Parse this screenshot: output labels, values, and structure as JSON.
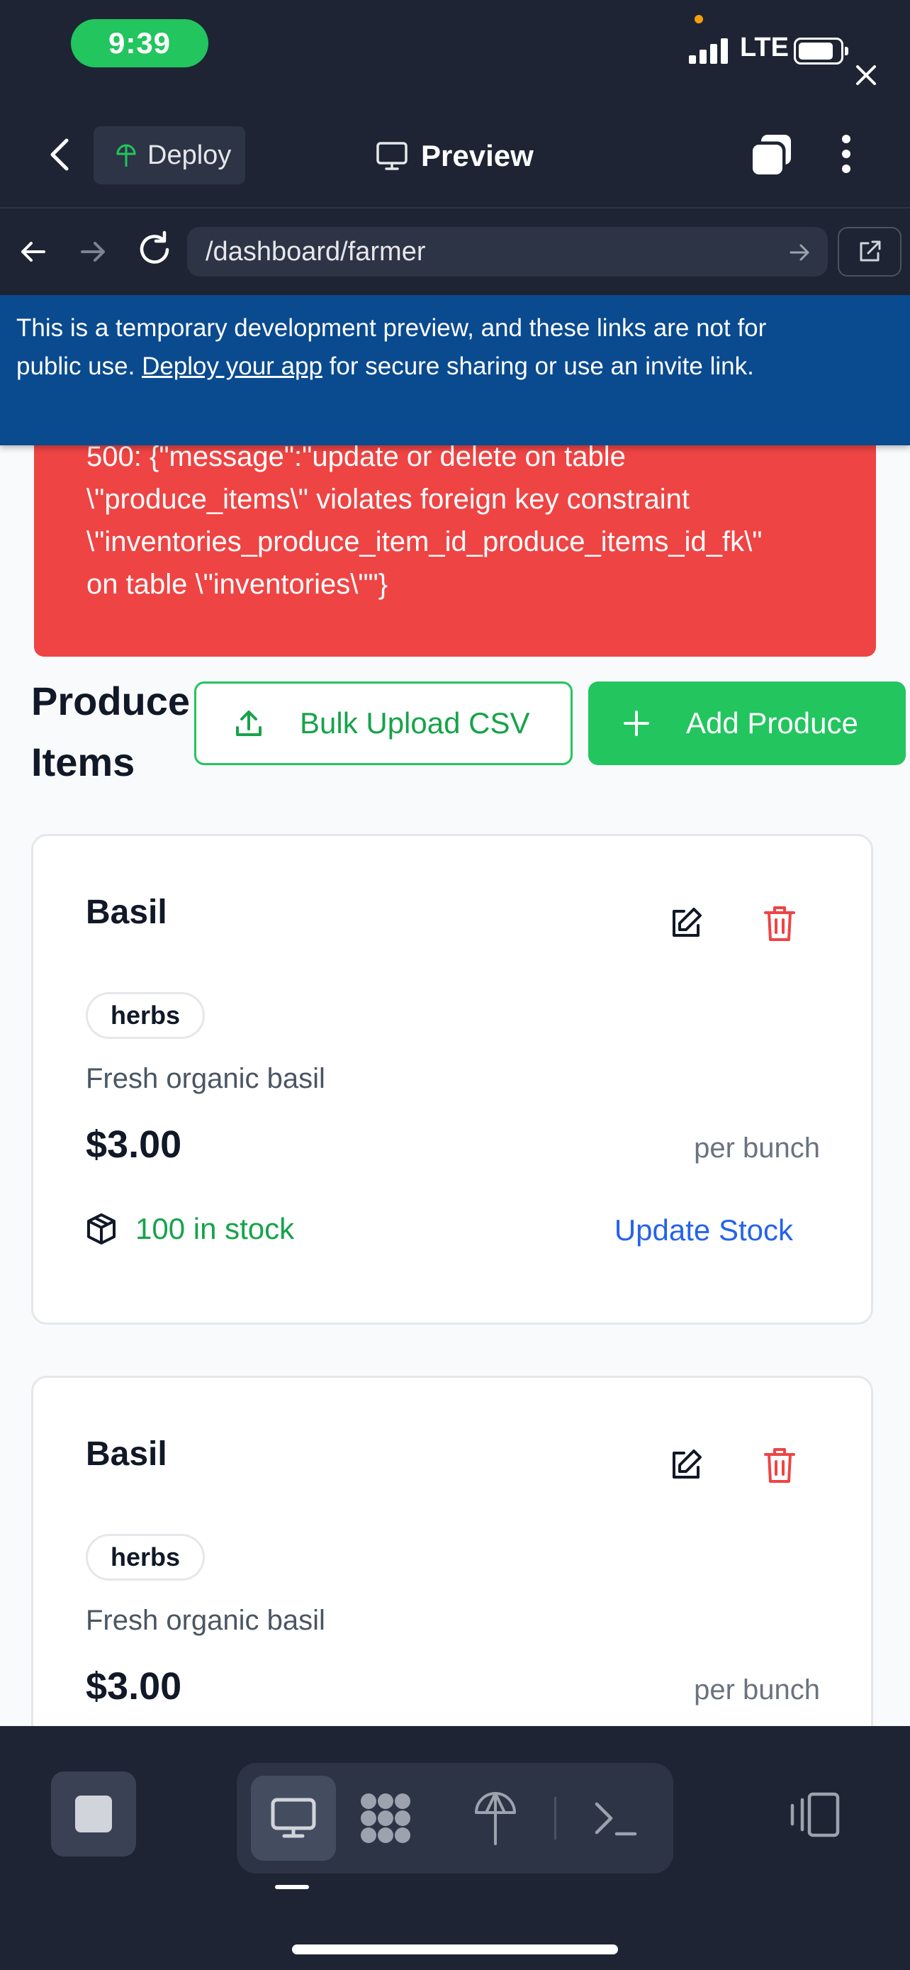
{
  "status_bar": {
    "time": "9:39",
    "network": "LTE"
  },
  "header": {
    "deploy_label": "Deploy",
    "preview_label": "Preview"
  },
  "browser": {
    "url": "/dashboard/farmer"
  },
  "notice": {
    "text_before": "This is a temporary development preview, and these links are not for public use. ",
    "link_text": "Deploy your app",
    "text_after": " for secure sharing or use an invite link."
  },
  "error": {
    "message": "500: {\"message\":\"update or delete on table\n\\\"produce_items\\\" violates foreign key constraint\n\\\"inventories_produce_item_id_produce_items_id_fk\\\"\non table \\\"inventories\\\"\"}"
  },
  "section": {
    "title": "Produce Items",
    "bulk_upload_label": "Bulk Upload CSV",
    "add_label": "Add Produce"
  },
  "products": [
    {
      "name": "Basil",
      "tag": "herbs",
      "description": "Fresh organic basil",
      "price": "$3.00",
      "unit": "per bunch",
      "stock": "100 in stock",
      "update_label": "Update Stock"
    },
    {
      "name": "Basil",
      "tag": "herbs",
      "description": "Fresh organic basil",
      "price": "$3.00",
      "unit": "per bunch",
      "stock": "",
      "update_label": ""
    }
  ],
  "colors": {
    "background_dark": "#1e2433",
    "accent_green": "#22c55e",
    "error_red": "#ef4444",
    "notice_blue": "#0a4a8f",
    "link_blue": "#2563eb"
  }
}
